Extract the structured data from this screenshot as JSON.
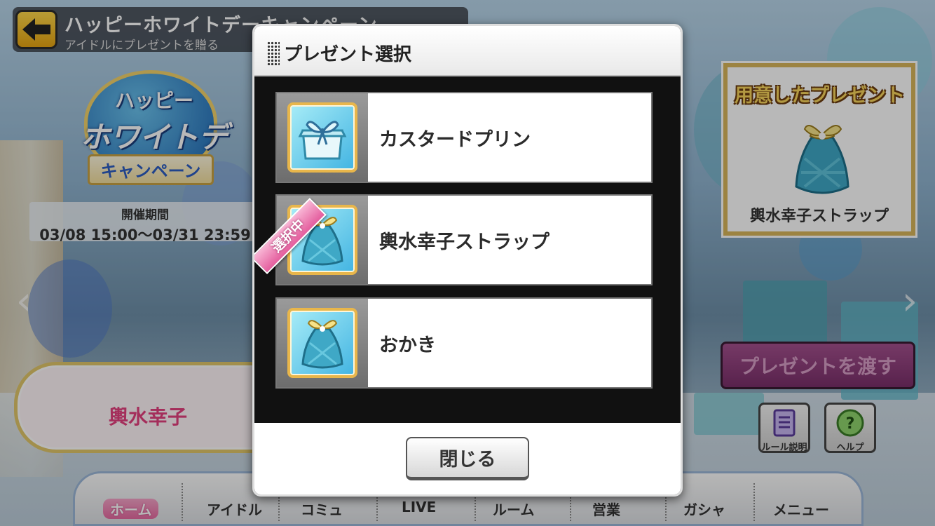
{
  "header": {
    "title": "ハッピーホワイトデーキャンペーン",
    "subtitle": "アイドルにプレゼントを贈る"
  },
  "event_logo": {
    "line1": "ハッピー",
    "line2": "ホワイトデー",
    "line3": "キャンペーン"
  },
  "period": {
    "label": "開催期間",
    "value": "03/08 15:00〜03/31 23:59"
  },
  "idol": {
    "name": "輿水幸子"
  },
  "prepared_present": {
    "title": "用意したプレゼント",
    "name": "輿水幸子ストラップ",
    "icon": "gift-bag-icon"
  },
  "actions": {
    "give_present": "プレゼントを渡す",
    "rule": "ルール説明",
    "help": "ヘルプ"
  },
  "nav": {
    "items": [
      {
        "label": "ホーム",
        "icon": "castle-icon",
        "active": true
      },
      {
        "label": "アイドル",
        "icon": "idol-portrait-icon"
      },
      {
        "label": "コミュ",
        "icon": "chat-icon"
      },
      {
        "label": "LIVE",
        "icon": "live-icon"
      },
      {
        "label": "ルーム",
        "icon": "room-icon"
      },
      {
        "label": "営業",
        "icon": "work-icon"
      },
      {
        "label": "ガシャ",
        "icon": "gacha-icon"
      },
      {
        "label": "メニュー",
        "icon": "menu-book-icon"
      }
    ]
  },
  "modal": {
    "title": "プレゼント選択",
    "selected_badge": "選択中",
    "items": [
      {
        "name": "カスタードプリン",
        "icon": "pudding-gift-icon"
      },
      {
        "name": "輿水幸子ストラップ",
        "icon": "gift-bag-icon",
        "selected": true
      },
      {
        "name": "おかき",
        "icon": "gift-bag-icon"
      }
    ],
    "close_label": "閉じる"
  },
  "colors": {
    "accent_pink": "#e4407e",
    "gold_frame": "#d9b65a",
    "give_button": "#8a3a78"
  }
}
